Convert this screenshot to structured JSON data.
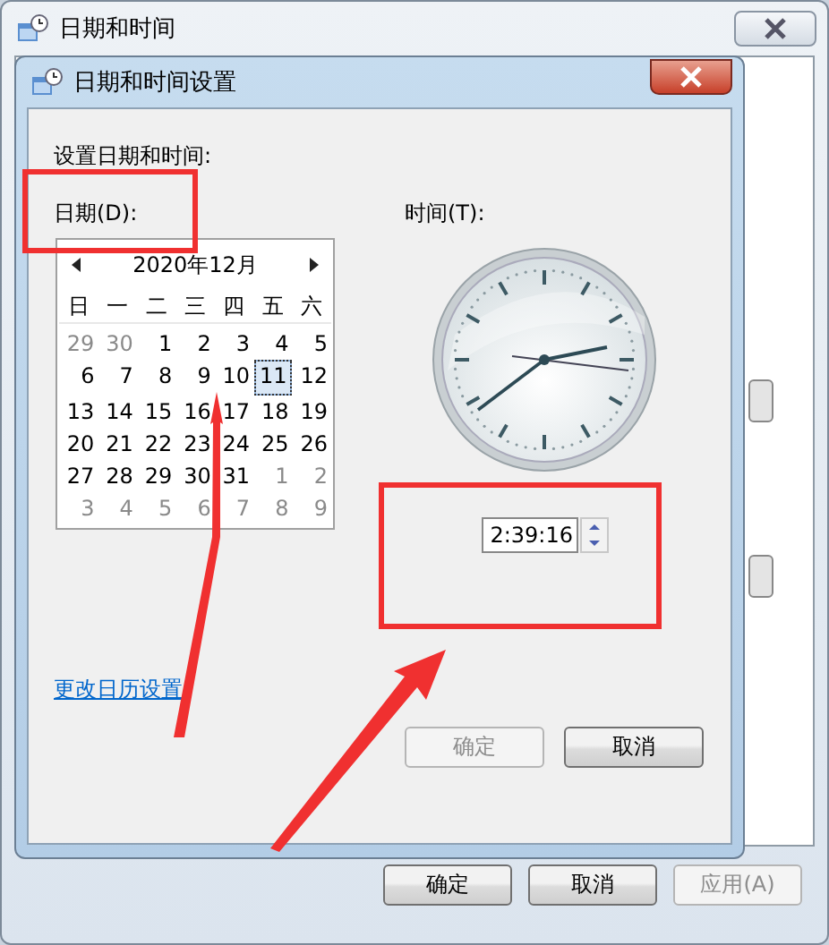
{
  "window": {
    "title": "日期和时间"
  },
  "dialog": {
    "title": "日期和时间设置",
    "heading": "设置日期和时间:",
    "date_label": "日期(D):",
    "time_label": "时间(T):",
    "calendar": {
      "month": "2020年12月",
      "weekdays": [
        "日",
        "一",
        "二",
        "三",
        "四",
        "五",
        "六"
      ],
      "weeks": [
        [
          {
            "day": "29",
            "other_month": true,
            "selected": false
          },
          {
            "day": "30",
            "other_month": true,
            "selected": false
          },
          {
            "day": "1",
            "other_month": false,
            "selected": false
          },
          {
            "day": "2",
            "other_month": false,
            "selected": false
          },
          {
            "day": "3",
            "other_month": false,
            "selected": false
          },
          {
            "day": "4",
            "other_month": false,
            "selected": false
          },
          {
            "day": "5",
            "other_month": false,
            "selected": false
          }
        ],
        [
          {
            "day": "6",
            "other_month": false,
            "selected": false
          },
          {
            "day": "7",
            "other_month": false,
            "selected": false
          },
          {
            "day": "8",
            "other_month": false,
            "selected": false
          },
          {
            "day": "9",
            "other_month": false,
            "selected": false
          },
          {
            "day": "10",
            "other_month": false,
            "selected": false
          },
          {
            "day": "11",
            "other_month": false,
            "selected": true
          },
          {
            "day": "12",
            "other_month": false,
            "selected": false
          }
        ],
        [
          {
            "day": "13",
            "other_month": false,
            "selected": false
          },
          {
            "day": "14",
            "other_month": false,
            "selected": false
          },
          {
            "day": "15",
            "other_month": false,
            "selected": false
          },
          {
            "day": "16",
            "other_month": false,
            "selected": false
          },
          {
            "day": "17",
            "other_month": false,
            "selected": false
          },
          {
            "day": "18",
            "other_month": false,
            "selected": false
          },
          {
            "day": "19",
            "other_month": false,
            "selected": false
          }
        ],
        [
          {
            "day": "20",
            "other_month": false,
            "selected": false
          },
          {
            "day": "21",
            "other_month": false,
            "selected": false
          },
          {
            "day": "22",
            "other_month": false,
            "selected": false
          },
          {
            "day": "23",
            "other_month": false,
            "selected": false
          },
          {
            "day": "24",
            "other_month": false,
            "selected": false
          },
          {
            "day": "25",
            "other_month": false,
            "selected": false
          },
          {
            "day": "26",
            "other_month": false,
            "selected": false
          }
        ],
        [
          {
            "day": "27",
            "other_month": false,
            "selected": false
          },
          {
            "day": "28",
            "other_month": false,
            "selected": false
          },
          {
            "day": "29",
            "other_month": false,
            "selected": false
          },
          {
            "day": "30",
            "other_month": false,
            "selected": false
          },
          {
            "day": "31",
            "other_month": false,
            "selected": false
          },
          {
            "day": "1",
            "other_month": true,
            "selected": false
          },
          {
            "day": "2",
            "other_month": true,
            "selected": false
          }
        ],
        [
          {
            "day": "3",
            "other_month": true,
            "selected": false
          },
          {
            "day": "4",
            "other_month": true,
            "selected": false
          },
          {
            "day": "5",
            "other_month": true,
            "selected": false
          },
          {
            "day": "6",
            "other_month": true,
            "selected": false
          },
          {
            "day": "7",
            "other_month": true,
            "selected": false
          },
          {
            "day": "8",
            "other_month": true,
            "selected": false
          },
          {
            "day": "9",
            "other_month": true,
            "selected": false
          }
        ]
      ]
    },
    "time": "2:39:16",
    "link": "更改日历设置",
    "buttons": [
      {
        "label": "确定",
        "disabled": true
      },
      {
        "label": "取消",
        "disabled": false
      }
    ]
  },
  "buttons": [
    {
      "label": "确定",
      "disabled": false
    },
    {
      "label": "取消",
      "disabled": false
    },
    {
      "label": "应用(A)",
      "disabled": true
    }
  ]
}
